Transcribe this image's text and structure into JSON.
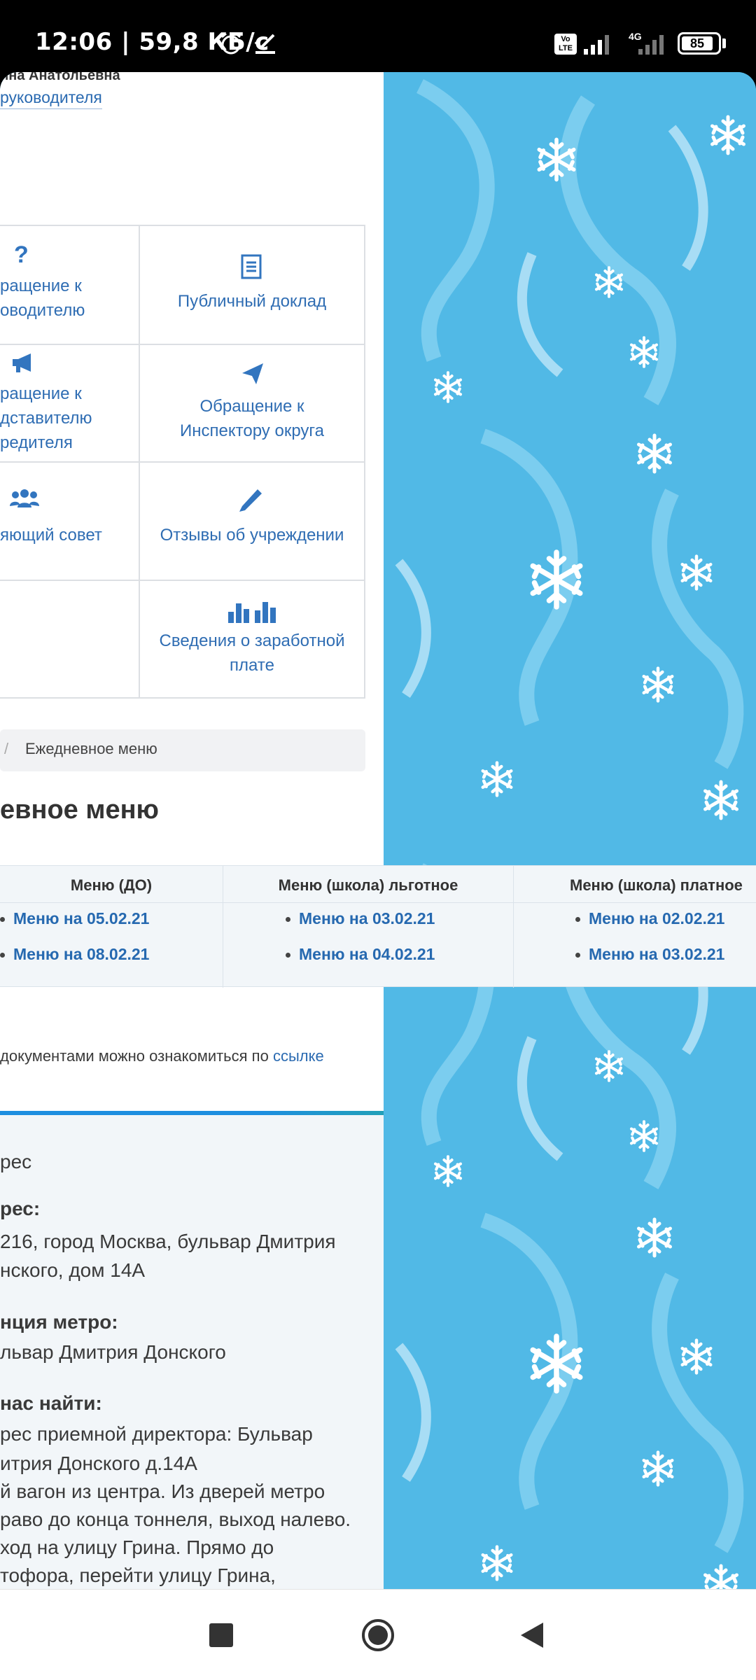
{
  "status_bar": {
    "time": "12:06 | 59,8 КБ/с",
    "battery": "85",
    "network_label": "4G",
    "volte_label": "Vo LTE"
  },
  "header": {
    "name_fragment": "ина Анатольевна",
    "role_link_fragment": "руководителя"
  },
  "grid": {
    "items": [
      {
        "icon": "question-icon",
        "label_lines": [
          "ращение к",
          "оводителю"
        ]
      },
      {
        "icon": "document-icon",
        "label_lines": [
          "Публичный доклад"
        ]
      },
      {
        "icon": "megaphone-icon",
        "label_lines": [
          "ращение к",
          "дставителю",
          "редителя"
        ]
      },
      {
        "icon": "paper-plane-icon",
        "label_lines": [
          "Обращение к",
          "Инспектору округа"
        ]
      },
      {
        "icon": "users-icon",
        "label_lines": [
          "яющий совет"
        ]
      },
      {
        "icon": "pencil-icon",
        "label_lines": [
          "Отзывы об учреждении"
        ]
      },
      {
        "icon": "bar-chart-icon",
        "label_lines": [
          "Сведения о заработной",
          "плате"
        ]
      }
    ]
  },
  "breadcrumb": {
    "separator": "/",
    "current": "Ежедневное меню"
  },
  "page_title": "евное меню",
  "menu_table": {
    "columns": [
      {
        "header": "Меню (ДО)",
        "items": [
          "Меню на 05.02.21",
          "Меню на 08.02.21"
        ]
      },
      {
        "header": "Меню (школа) льготное",
        "items": [
          "Меню на 03.02.21",
          "Меню на 04.02.21"
        ]
      },
      {
        "header": "Меню (школа) платное",
        "items": [
          "Меню на 02.02.21",
          "Меню на 03.02.21"
        ]
      }
    ]
  },
  "documents_note": {
    "text": "документами можно ознакомиться по ",
    "link": "ссылке"
  },
  "address_section": {
    "title": "рес",
    "address_label": "рес:",
    "address_lines": [
      "216, город Москва, бульвар Дмитрия",
      "нского, дом 14А"
    ],
    "metro_label": "нция метро:",
    "metro_value": "львар Дмитрия Донского",
    "find_label": " нас найти:",
    "find_lines": [
      "рес приемной директора: Бульвар",
      "итрия Донского д.14А",
      "й вагон из центра. Из дверей метро",
      "раво до конца тоннеля, выход налево.",
      "ход на улицу Грина. Прямо до",
      "тофора, перейти улицу Грина,"
    ]
  },
  "colors": {
    "link": "#2669b0",
    "background_pattern": "#51b9e6",
    "accent_bar": "#1e8fe0"
  }
}
